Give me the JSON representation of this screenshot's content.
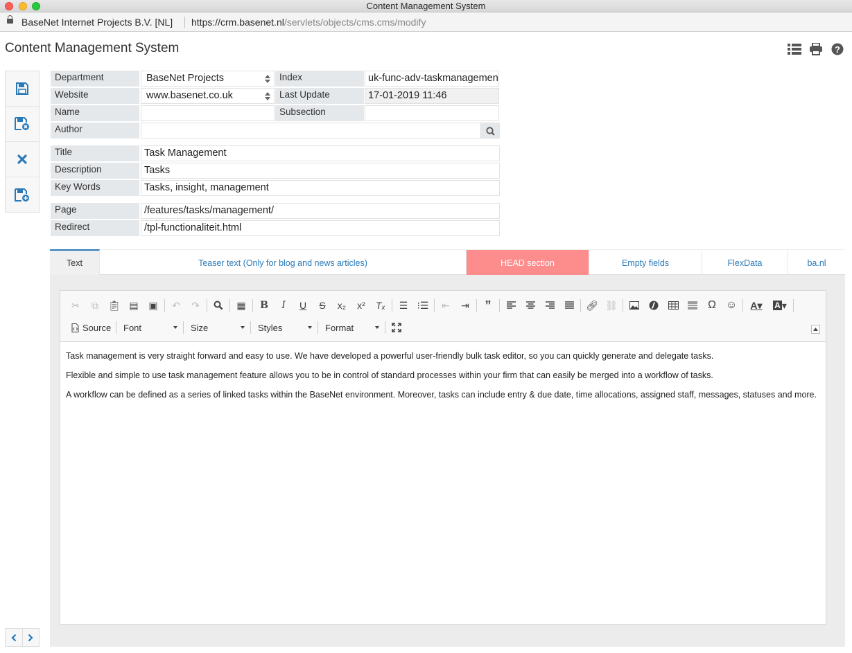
{
  "window": {
    "title": "Content Management System"
  },
  "address": {
    "site_owner": "BaseNet Internet Projects B.V. [NL]",
    "url_host": "https://crm.basenet.nl",
    "url_path": "/servlets/objects/cms.cms/modify"
  },
  "header": {
    "title": "Content Management System",
    "icons": [
      "list-view-icon",
      "print-icon",
      "help-icon"
    ]
  },
  "side_toolbar": {
    "icons": [
      "save-icon",
      "save-close-icon",
      "close-icon",
      "save-new-icon"
    ]
  },
  "form": {
    "department_label": "Department",
    "department_value": "BaseNet Projects",
    "index_label": "Index",
    "index_value": "uk-func-adv-taskmanagement",
    "website_label": "Website",
    "website_value": "www.basenet.co.uk",
    "last_update_label": "Last Update",
    "last_update_value": "17-01-2019 11:46",
    "name_label": "Name",
    "name_value": "",
    "subsection_label": "Subsection",
    "subsection_value": "",
    "author_label": "Author",
    "author_value": "",
    "title_label": "Title",
    "title_value": "Task Management",
    "description_label": "Description",
    "description_value": "Tasks",
    "keywords_label": "Key Words",
    "keywords_value": "Tasks, insight, management",
    "page_label": "Page",
    "page_value": "/features/tasks/management/",
    "redirect_label": "Redirect",
    "redirect_value": "/tpl-functionaliteit.html"
  },
  "tabs": [
    {
      "label": "Text"
    },
    {
      "label": "Teaser text (Only for blog and news articles)"
    },
    {
      "label": "HEAD section"
    },
    {
      "label": "Empty fields"
    },
    {
      "label": "FlexData"
    },
    {
      "label": "ba.nl"
    }
  ],
  "editor": {
    "source_label": "Source",
    "font_label": "Font",
    "size_label": "Size",
    "styles_label": "Styles",
    "format_label": "Format",
    "paragraphs": [
      "Task management is very straight forward and easy to use. We have developed a powerful user-friendly bulk task editor, so you can quickly generate and delegate tasks.",
      "Flexible and simple to use task management feature allows you to be in control of standard processes within your firm that can easily be merged into a workflow of tasks.",
      "A workflow can be defined as a series of linked tasks within the BaseNet environment. Moreover, tasks can include entry & due date, time allocations, assigned staff, messages, statuses and more."
    ]
  },
  "colors": {
    "accent": "#2a7ab8",
    "head_tab": "#fd8c8c",
    "label_bg": "#e5e8eb"
  }
}
